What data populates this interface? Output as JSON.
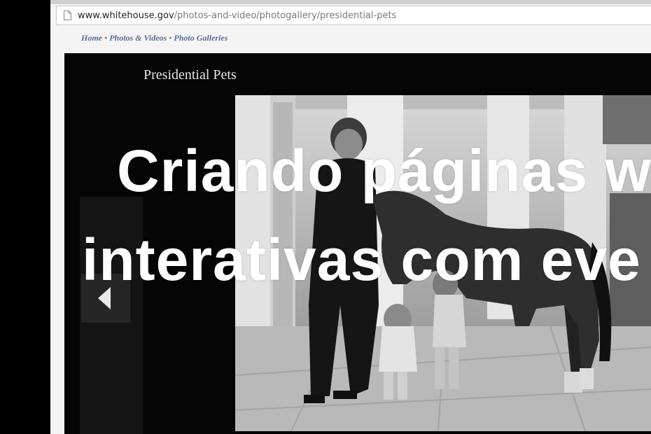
{
  "browser": {
    "url_host": "www.whitehouse.gov",
    "url_path": "/photos-and-video/photogallery/presidential-pets"
  },
  "breadcrumb": {
    "items": [
      "Home",
      "Photos & Videos",
      "Photo Galleries"
    ],
    "separator": "•"
  },
  "gallery": {
    "title": "Presidential Pets",
    "prev_icon": "triangle-left-icon"
  },
  "overlay": {
    "line1": "Criando páginas w",
    "line2": "interativas com eve"
  }
}
